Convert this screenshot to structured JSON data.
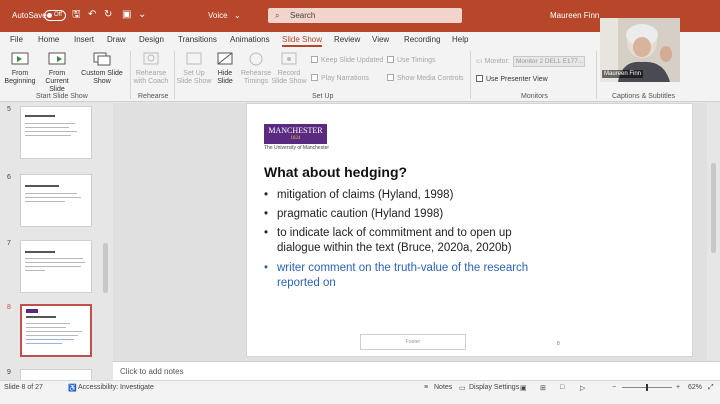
{
  "titlebar": {
    "autosave_label": "AutoSave",
    "autosave_state": "Off",
    "doc_title": "Voice",
    "search_placeholder": "Search",
    "user_name": "Maureen Finn"
  },
  "menu": {
    "items": [
      "File",
      "Home",
      "Insert",
      "Draw",
      "Design",
      "Transitions",
      "Animations",
      "Slide Show",
      "Review",
      "View",
      "Recording",
      "Help"
    ],
    "active": "Slide Show"
  },
  "ribbon": {
    "start": {
      "from_beginning": "From Beginning",
      "from_current": "From Current Slide",
      "custom": "Custom Slide Show",
      "label": "Start Slide Show"
    },
    "rehearse": {
      "button": "Rehearse with Coach",
      "label": "Rehearse"
    },
    "setup": {
      "setup_show": "Set Up Slide Show",
      "hide_slide": "Hide Slide",
      "rehearse_timings": "Rehearse Timings",
      "record": "Record Slide Show",
      "keep_updated": "Keep Slide Updated",
      "play_narrations": "Play Narrations",
      "use_timings": "Use Timings",
      "show_media": "Show Media Controls",
      "label": "Set Up"
    },
    "monitors": {
      "monitor_label": "Monitor:",
      "monitor_value": "Monitor 2 DELL E177...",
      "presenter_view": "Use Presenter View",
      "label": "Monitors"
    },
    "captions": {
      "label": "Captions & Subtitles"
    }
  },
  "webcam": {
    "name": "Maureen Finn"
  },
  "thumbnails": [
    {
      "num": "5",
      "title": "Conclusions (so far ...)"
    },
    {
      "num": "6",
      "title": "In the TLP classroom"
    },
    {
      "num": "7",
      "title": "What about stance?"
    },
    {
      "num": "8",
      "title": "What about hedging?"
    },
    {
      "num": "9",
      "title": ""
    }
  ],
  "slide": {
    "logo": "MANCHESTER",
    "logo_year": "1824",
    "university": "The University of Manchester",
    "title": "What about hedging?",
    "bullets": [
      "mitigation of claims (Hyland, 1998)",
      "pragmatic caution (Hyland 1998)",
      "to indicate lack of commitment and to open up dialogue within the text (Bruce, 2020a, 2020b)",
      "writer comment on the truth-value of the research reported on"
    ],
    "footer": "Footer",
    "page": "8"
  },
  "notes": {
    "placeholder": "Click to add notes"
  },
  "status": {
    "slide": "Slide 8 of 27",
    "accessibility": "Accessibility: Investigate",
    "notes": "Notes",
    "display": "Display Settings",
    "zoom": "62%"
  },
  "colors": {
    "accent": "#b7472a",
    "blue_bullet": "#2d63b5",
    "manchester_purple": "#5a2a80"
  }
}
